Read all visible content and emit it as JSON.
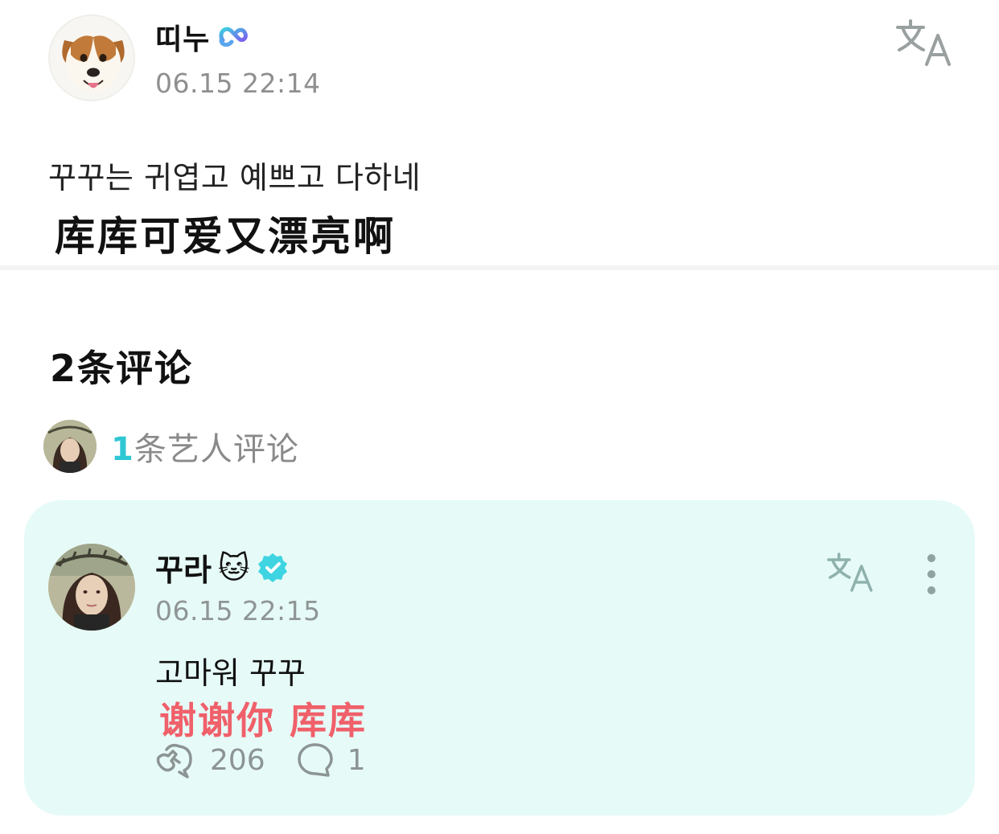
{
  "post": {
    "author": "띠누",
    "author_badge_icon": "weverse-infinity-badge-icon",
    "timestamp": "06.15 22:14",
    "text_korean": "꾸꾸는 귀엽고 예쁘고 다하네",
    "text_chinese": "库库可爱又漂亮啊",
    "translate_icon": "translate-icon"
  },
  "comments": {
    "title": "2条评论",
    "artist_summary": {
      "count": "1",
      "label": "条艺人评论"
    },
    "items": [
      {
        "author": "꾸라",
        "author_emoji": "🐱",
        "verified_icon": "verified-badge-icon",
        "timestamp": "06.15 22:15",
        "text_korean": "고마워 꾸꾸",
        "text_chinese": "谢谢你 库库",
        "likes": "206",
        "replies": "1"
      }
    ]
  },
  "colors": {
    "accent_teal": "#2fc7d4",
    "comment_card_bg": "#e6fbf7",
    "chinese_comment_red": "#f0606a",
    "muted_gray": "#8f8f8f"
  }
}
